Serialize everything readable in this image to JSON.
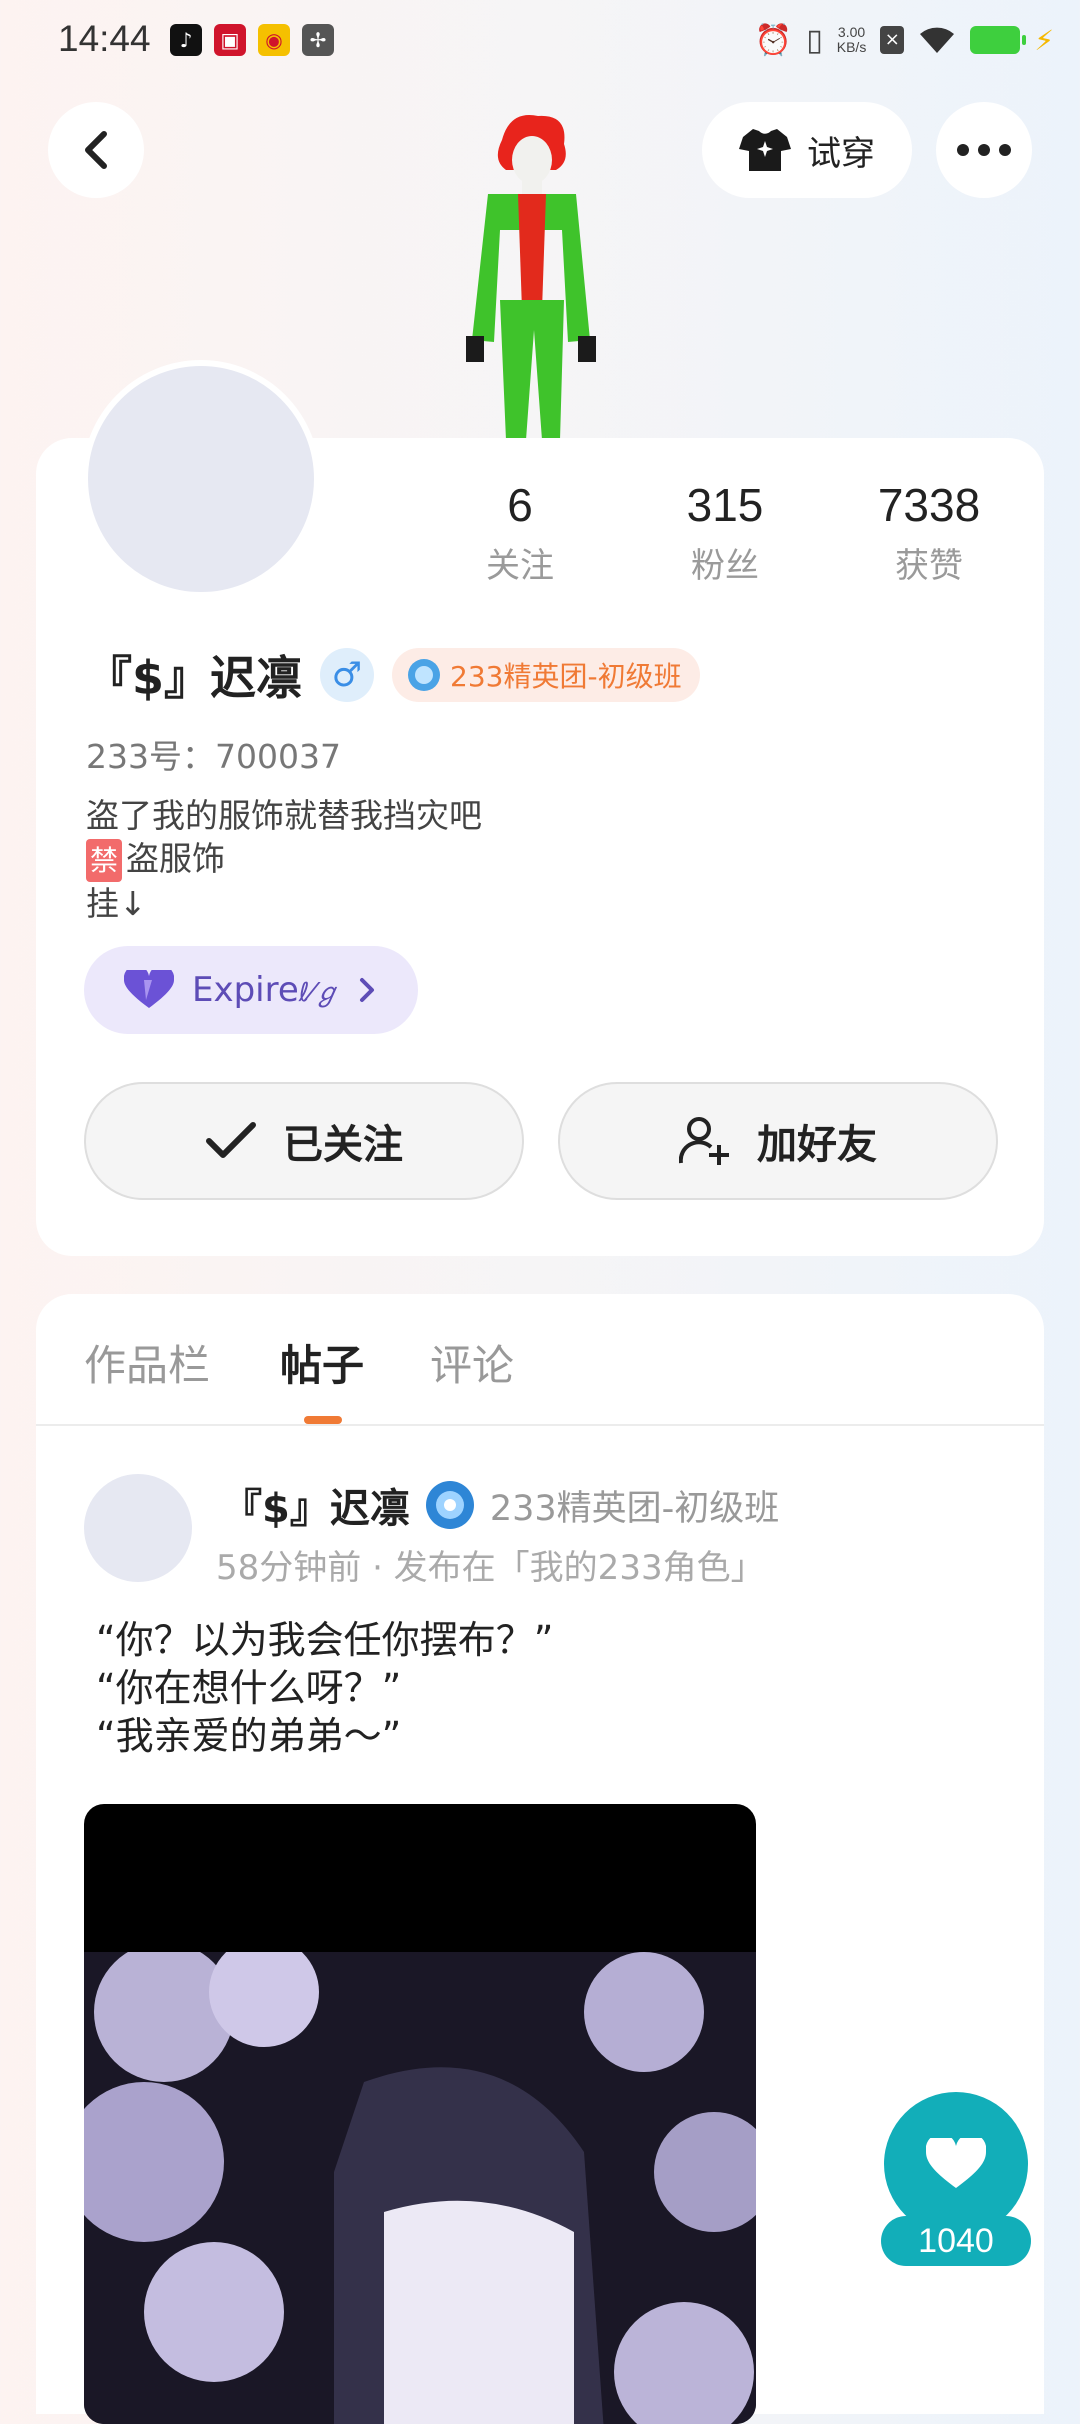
{
  "status_bar": {
    "time": "14:44",
    "app_icons": [
      "tiktok-icon",
      "video-app-icon",
      "weibo-icon",
      "app-icon"
    ],
    "network_speed_value": "3.00",
    "network_speed_unit": "KB/s"
  },
  "header": {
    "try_on_label": "试穿"
  },
  "profile": {
    "stats": [
      {
        "value": "6",
        "label": "关注"
      },
      {
        "value": "315",
        "label": "粉丝"
      },
      {
        "value": "7338",
        "label": "获赞"
      }
    ],
    "username": "『$』迟凛",
    "gender_symbol": "♂",
    "rank": "233精英团-初级班",
    "user_id": "233号：700037",
    "bio_line1": "盗了我的服饰就替我挡灾吧",
    "bio_ban_tag": "禁",
    "bio_line2_rest": "盗服饰",
    "bio_line3": "挂↓",
    "group_name": "Expire",
    "group_suffix": "ℓ⁄ℊ",
    "followed_label": "已关注",
    "add_friend_label": "加好友"
  },
  "tabs": [
    {
      "label": "作品栏",
      "active": false
    },
    {
      "label": "帖子",
      "active": true
    },
    {
      "label": "评论",
      "active": false
    }
  ],
  "post": {
    "author": "『$』迟凛",
    "author_rank": "233精英团-初级班",
    "meta": "58分钟前 · 发布在「我的233角色」",
    "line1": "“你？以为我会任你摆布？”",
    "line2": "“你在想什么呀？”",
    "line3": "“我亲爱的弟弟～”"
  },
  "like": {
    "count": "1040"
  },
  "colors": {
    "accent_orange": "#f07a35",
    "like_teal": "#12aeb9",
    "group_purple": "#5d4cb6"
  }
}
